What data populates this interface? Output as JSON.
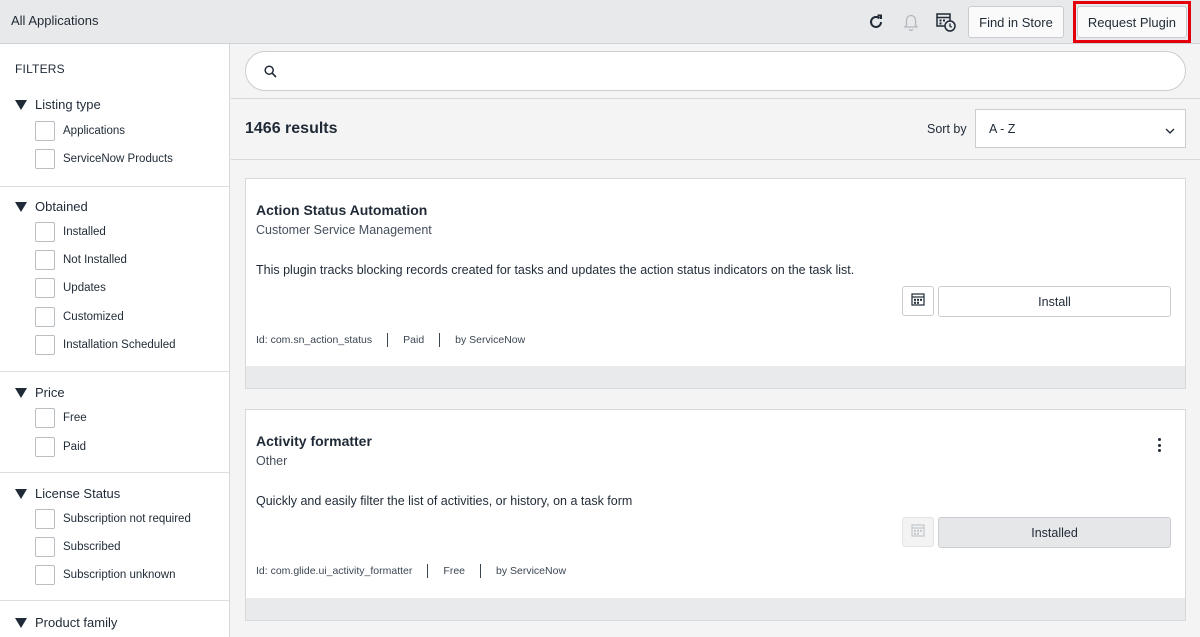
{
  "header": {
    "title": "All Applications",
    "find_in_store": "Find in Store",
    "request_plugin": "Request Plugin",
    "icons": [
      "refresh-icon",
      "bell-icon",
      "calendar-clock-icon"
    ]
  },
  "sidebar": {
    "title": "FILTERS",
    "groups": [
      {
        "label": "Listing type",
        "options": [
          "Applications",
          "ServiceNow Products"
        ]
      },
      {
        "label": "Obtained",
        "options": [
          "Installed",
          "Not Installed",
          "Updates",
          "Customized",
          "Installation Scheduled"
        ]
      },
      {
        "label": "Price",
        "options": [
          "Free",
          "Paid"
        ]
      },
      {
        "label": "License Status",
        "options": [
          "Subscription not required",
          "Subscribed",
          "Subscription unknown"
        ]
      },
      {
        "label": "Product family",
        "options": []
      }
    ]
  },
  "search": {
    "placeholder": ""
  },
  "results": {
    "count_label": "1466 results",
    "sort_label": "Sort by",
    "sort_value": "A - Z"
  },
  "cards": [
    {
      "title": "Action Status Automation",
      "category": "Customer Service Management",
      "description": "This plugin tracks blocking records created for tasks and updates the action status indicators on the task list.",
      "action": "Install",
      "id": "Id: com.sn_action_status",
      "price": "Paid",
      "vendor": "by ServiceNow"
    },
    {
      "title": "Activity formatter",
      "category": "Other",
      "description": "Quickly and easily filter the list of activities, or history, on a task form",
      "action": "Installed",
      "id": "Id: com.glide.ui_activity_formatter",
      "price": "Free",
      "vendor": "by ServiceNow"
    }
  ],
  "colors": {
    "highlight": "#e3000b",
    "topbar": "#e8e9ea",
    "text": "#1f2a36"
  }
}
